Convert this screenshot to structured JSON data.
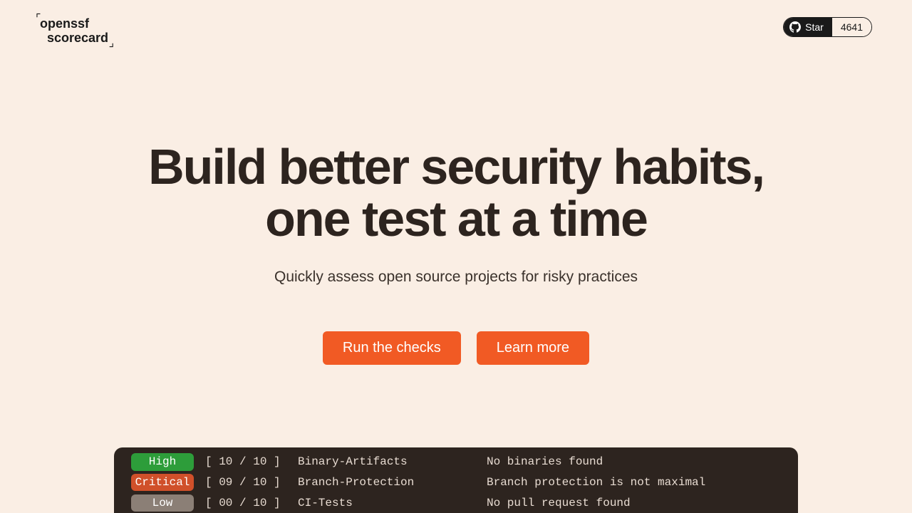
{
  "logo": {
    "line1": "openssf",
    "line2": "scorecard"
  },
  "github": {
    "star_label": "Star",
    "count": "4641"
  },
  "hero": {
    "title_line1": "Build better security habits,",
    "title_line2": "one test at a time",
    "subtitle": "Quickly assess open source projects for risky practices"
  },
  "cta": {
    "primary": "Run the checks",
    "secondary": "Learn more"
  },
  "terminal": {
    "rows": [
      {
        "severity": "High",
        "score": "[ 10 / 10 ]",
        "check": "Binary-Artifacts",
        "desc": "No binaries found"
      },
      {
        "severity": "Critical",
        "score": "[ 09 / 10 ]",
        "check": "Branch-Protection",
        "desc": "Branch protection is not maximal"
      },
      {
        "severity": "Low",
        "score": "[ 00 / 10 ]",
        "check": "CI-Tests",
        "desc": "No pull request found"
      }
    ]
  }
}
